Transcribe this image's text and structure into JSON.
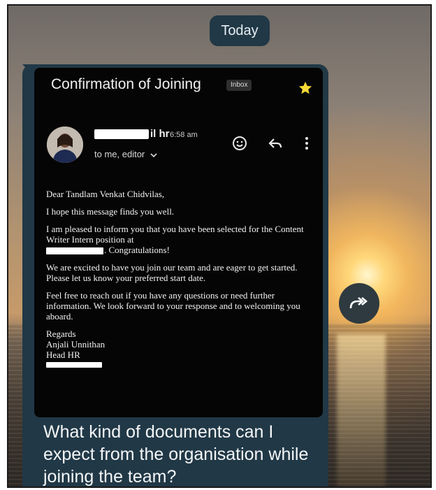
{
  "date_chip": {
    "label": "Today"
  },
  "email": {
    "subject": "Confirmation of Joining",
    "label": "Inbox",
    "sender_visible": "il hr",
    "time": "6:58 am",
    "recipients": "to me, editor",
    "body": {
      "greeting": "Dear Tandlam Venkat Chidvilas,",
      "p1": "I hope this message finds you well.",
      "p2_before": "I am pleased to inform you that you have been selected for the Content Writer Intern position at",
      "p2_after": ". Congratulations!",
      "p3": "We are excited to have you join our team and are eager to get started. Please let us know your preferred start date.",
      "p4": "Feel free to reach out if you have any questions or need further information. We look forward to your response and to welcoming you aboard.",
      "signoff": "Regards",
      "name": "Anjali Unnithan",
      "role": "Head HR"
    }
  },
  "message": {
    "caption": "What kind of documents can I expect from the organisation while joining the team?"
  },
  "colors": {
    "bubble": "#213846",
    "card": "#050505",
    "star": "#f6d935"
  },
  "icons": [
    "star-icon",
    "emoji-icon",
    "reply-icon",
    "more-vert-icon",
    "chevron-down-icon",
    "forward-icon"
  ]
}
